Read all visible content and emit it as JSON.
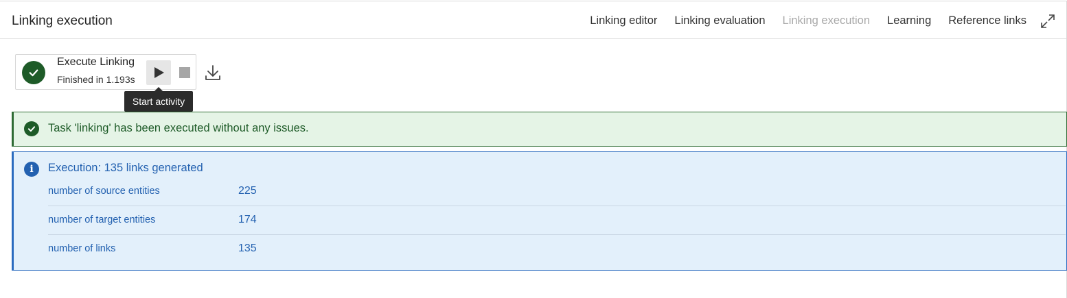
{
  "header": {
    "title": "Linking execution",
    "nav": [
      {
        "label": "Linking editor",
        "active": false
      },
      {
        "label": "Linking evaluation",
        "active": false
      },
      {
        "label": "Linking execution",
        "active": true
      },
      {
        "label": "Learning",
        "active": false
      },
      {
        "label": "Reference links",
        "active": false
      }
    ],
    "expand_icon": "expand-icon"
  },
  "activity": {
    "title": "Execute Linking",
    "status": "Finished in 1.193s",
    "status_icon": "check-circle-icon",
    "play_icon": "play-icon",
    "stop_icon": "stop-icon",
    "download_icon": "download-icon",
    "tooltip": "Start activity"
  },
  "success": {
    "message": "Task 'linking' has been executed without any issues.",
    "icon": "check-circle-icon"
  },
  "info": {
    "title": "Execution: 135 links generated",
    "icon": "info-icon",
    "stats": [
      {
        "label": "number of source entities",
        "value": "225"
      },
      {
        "label": "number of target entities",
        "value": "174"
      },
      {
        "label": "number of links",
        "value": "135"
      }
    ]
  },
  "colors": {
    "success_bg": "#e5f4e6",
    "success_accent": "#1e5b28",
    "info_bg": "#e3f0fb",
    "info_accent": "#2361b0",
    "nav_active": "#a8a8a8"
  }
}
